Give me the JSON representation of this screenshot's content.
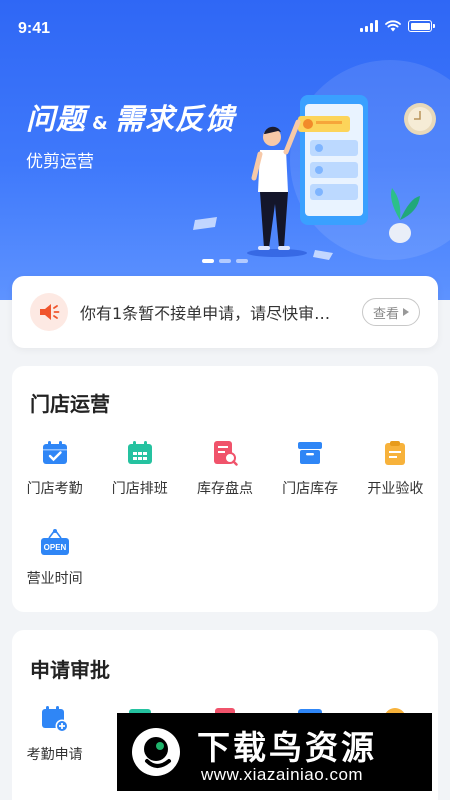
{
  "status_bar": {
    "time": "9:41"
  },
  "banner": {
    "title_part1": "问题",
    "ampersand": "&",
    "title_part2": "需求反馈",
    "subtitle": "优剪运营",
    "dots": 3,
    "active_dot": 0
  },
  "notice": {
    "text": "你有1条暂不接单申请，请尽快审…",
    "view_label": "查看"
  },
  "store_ops": {
    "title": "门店运营",
    "items": [
      {
        "label": "门店考勤",
        "icon": "calendar-check-icon",
        "color": "#2f86f6"
      },
      {
        "label": "门店排班",
        "icon": "calendar-grid-icon",
        "color": "#25c2a0"
      },
      {
        "label": "库存盘点",
        "icon": "document-search-icon",
        "color": "#f0536b"
      },
      {
        "label": "门店库存",
        "icon": "inventory-box-icon",
        "color": "#2f86f6"
      },
      {
        "label": "开业验收",
        "icon": "clipboard-icon",
        "color": "#f7b23b"
      },
      {
        "label": "营业时间",
        "icon": "open-sign-icon",
        "color": "#2f86f6"
      }
    ]
  },
  "approval": {
    "title": "申请审批",
    "items": [
      {
        "label": "考勤申请",
        "icon": "calendar-plus-icon",
        "color": "#2f86f6"
      },
      {
        "label": "",
        "icon": "teal-icon",
        "color": "#25c2a0"
      },
      {
        "label": "",
        "icon": "red-icon",
        "color": "#f0536b"
      },
      {
        "label": "",
        "icon": "blue-icon",
        "color": "#2f86f6"
      },
      {
        "label": "",
        "icon": "orange-icon",
        "color": "#f7b23b"
      }
    ]
  },
  "watermark": {
    "title": "下载鸟资源",
    "url": "www.xiazainiao.com"
  }
}
